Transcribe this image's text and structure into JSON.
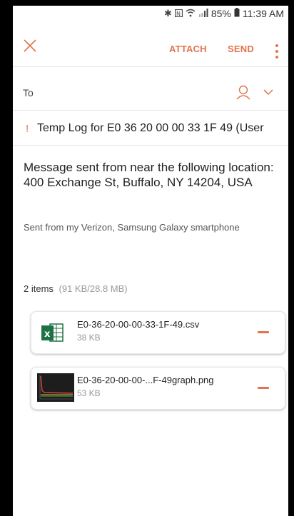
{
  "status_bar": {
    "icons": [
      "bluetooth-icon",
      "nfc-icon",
      "wifi-icon",
      "signal-icon",
      "battery-icon"
    ],
    "battery": "85%",
    "time": "11:39 AM"
  },
  "toolbar": {
    "attach_label": "ATTACH",
    "send_label": "SEND",
    "accent_color": "#e1744d"
  },
  "to_field": {
    "label": "To"
  },
  "subject": {
    "priority_mark": "!",
    "text": "Temp Log for E0 36 20 00 00 33 1F 49 (User"
  },
  "body": {
    "message": "Message sent from near the following location: 400 Exchange St, Buffalo, NY 14204, USA",
    "signature": "Sent from my Verizon, Samsung Galaxy smartphone"
  },
  "attachments": {
    "count_label": "2 items",
    "size_label": "(91 KB/28.8 MB)",
    "items": [
      {
        "name": "E0-36-20-00-00-33-1F-49.csv",
        "size": "38 KB",
        "icon": "excel-icon"
      },
      {
        "name": "E0-36-20-00-00-...F-49graph.png",
        "size": "53 KB",
        "icon": "image-thumbnail"
      }
    ]
  }
}
